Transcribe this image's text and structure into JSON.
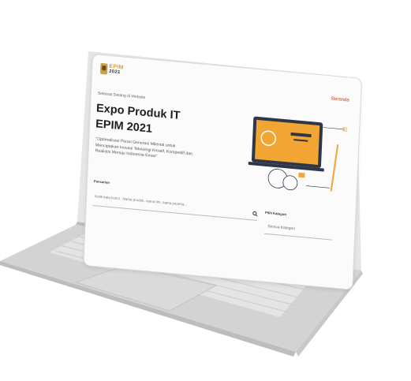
{
  "header": {
    "logo_alt": "EPIM 2021 logo",
    "nav_home": "Beranda"
  },
  "hero": {
    "welcome": "Selamat Datang di Website",
    "title_line1": "Expo Produk IT",
    "title_line2": "EPIM 2021",
    "tagline": "\"Optimalisasi Peran Generasi Milenial untuk Menciptakan Inovasi Teknologi Kreatif, Kompetitif dan Realistis Menuju Indonesia Emas\""
  },
  "search": {
    "label": "Pencarian",
    "placeholder": "Ketik kata kunci : Nama produk, nama tim, nama peserta...",
    "button_icon": "search-icon"
  },
  "category": {
    "label": "Pilih Kategori",
    "selected": "Semua Kategori"
  },
  "colors": {
    "accent": "#f2a533",
    "nav_link": "#b2401f",
    "laptop_body": "#d2d2d2"
  }
}
